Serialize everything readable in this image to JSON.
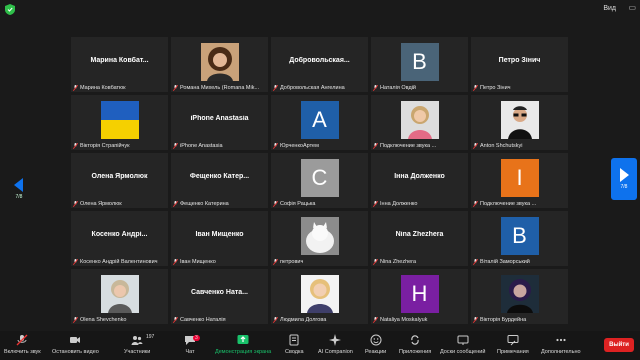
{
  "window": {
    "view_label": "Вид"
  },
  "colors": {
    "accent": "#0e72ed",
    "share_green": "#19c26b",
    "end_red": "#dd2222"
  },
  "pagination": {
    "left": "7/8",
    "right": "7/8"
  },
  "tiles": [
    {
      "name": "Марина  Ковбат...",
      "caption": "Марина Ковбатюк",
      "kind": "name"
    },
    {
      "name": "",
      "caption": "Романа Михель (Romana Mik...",
      "kind": "photo",
      "photo": "woman-curly"
    },
    {
      "name": "Добровольская...",
      "caption": "Добровольская Ангелина",
      "kind": "name"
    },
    {
      "name": "",
      "caption": "Наталія Овдій",
      "kind": "letter",
      "letter": "B",
      "color": "#4a6478"
    },
    {
      "name": "Петро Зінич",
      "caption": "Петро Зінич",
      "kind": "name"
    },
    {
      "name": "",
      "caption": "Вікторія Страпійчук",
      "kind": "flag"
    },
    {
      "name": "iPhone Anastasia",
      "caption": "iPhone Anastasia",
      "kind": "name"
    },
    {
      "name": "",
      "caption": "ЮрченкоАртем",
      "kind": "letter",
      "letter": "A",
      "color": "#1f5fa8"
    },
    {
      "name": "",
      "caption": "Подключение звука ...",
      "kind": "photo",
      "photo": "woman-light"
    },
    {
      "name": "",
      "caption": "Anton Shchutskyi",
      "kind": "photo",
      "photo": "man-glasses"
    },
    {
      "name": "Олена Ярмолюк",
      "caption": "Олена Ярмолюк",
      "kind": "name"
    },
    {
      "name": "Фещенко  Катер...",
      "caption": "Фещенко Катерина",
      "kind": "name"
    },
    {
      "name": "",
      "caption": "Софія Рацька",
      "kind": "letter",
      "letter": "C",
      "color": "#9b9b9b"
    },
    {
      "name": "Інна Долженко",
      "caption": "Інна Долженко",
      "kind": "name"
    },
    {
      "name": "",
      "caption": "Подключение звука ...",
      "kind": "letter",
      "letter": "I",
      "color": "#e8731a"
    },
    {
      "name": "Косенко  Андрі...",
      "caption": "Косенко Андрій Валентинович",
      "kind": "name"
    },
    {
      "name": "Іван Мищенко",
      "caption": "Іван Мищенко",
      "kind": "name"
    },
    {
      "name": "",
      "caption": "петрович",
      "kind": "photo",
      "photo": "cat"
    },
    {
      "name": "Nina Zhezhera",
      "caption": "Nina Zhezhera",
      "kind": "name"
    },
    {
      "name": "",
      "caption": "Віталій Заморський",
      "kind": "letter",
      "letter": "B",
      "color": "#1f5fa8"
    },
    {
      "name": "",
      "caption": "Olena Shevchenko",
      "kind": "photo",
      "photo": "woman-short"
    },
    {
      "name": "Савченко  Ната...",
      "caption": "Савченко Наталія",
      "kind": "name"
    },
    {
      "name": "",
      "caption": "Людмила Долгова",
      "kind": "photo",
      "photo": "woman-blonde"
    },
    {
      "name": "",
      "caption": "Nataliya Moskalyuk",
      "kind": "letter",
      "letter": "H",
      "color": "#7a1fa2"
    },
    {
      "name": "",
      "caption": "Вікторія Бурдейна",
      "kind": "photo",
      "photo": "woman-dark"
    }
  ],
  "toolbar": {
    "mute": "Включить звук",
    "video": "Остановить видео",
    "participants": "Участники",
    "participants_count": "197",
    "chat": "Чат",
    "chat_badge": "3",
    "share": "Демонстрация экрана",
    "notes": "Сводка",
    "ai": "AI Companion",
    "reactions": "Реакции",
    "apps": "Приложения",
    "whiteboards": "Доски сообщений",
    "annotate": "Примечания",
    "more": "Дополнительно",
    "end": "Выйти"
  }
}
